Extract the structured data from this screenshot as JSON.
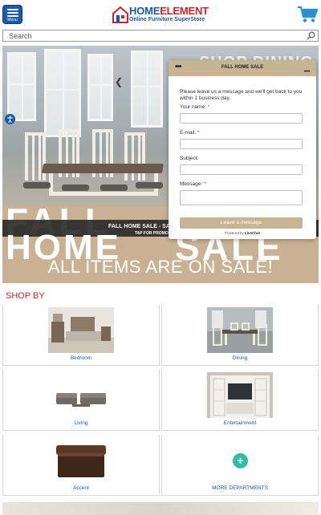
{
  "header": {
    "menu_label": "Menu",
    "brand_home": "HOME",
    "brand_element": "ELEMENT",
    "tagline": "Online Furniture SuperStore"
  },
  "search": {
    "placeholder": "Search"
  },
  "hero": {
    "headline_top": "SHOP DINING",
    "fall": "FALL",
    "home": "HOME",
    "sale": "SALE",
    "all_items": "ALL ITEMS ARE ON SALE!",
    "strip_text": "FALL HOME SALE - SA",
    "strip_sub": "TAP FOR PROMO"
  },
  "chat": {
    "title": "FALL HOME SALE",
    "intro": "Please leave us a message and we'll get back to you within 1 business day.",
    "fields": [
      {
        "label": "Your name:",
        "required": true
      },
      {
        "label": "E-mail:",
        "required": true
      },
      {
        "label": "Subject:",
        "required": false
      },
      {
        "label": "Message:",
        "required": true
      }
    ],
    "submit_label": "Leave a message",
    "powered_prefix": "Powered by",
    "powered_brand": "LiveChat"
  },
  "shop_by": {
    "title": "SHOP BY",
    "categories": [
      {
        "name": "Bedroom"
      },
      {
        "name": "Dining"
      },
      {
        "name": "Living"
      },
      {
        "name": "Entertainment"
      },
      {
        "name": "Accent"
      },
      {
        "name": "MORE DEPARTMENTS"
      }
    ]
  },
  "colors": {
    "brand_blue": "#1b5aa8",
    "brand_red": "#c9252c",
    "sale_tan": "#c9b293",
    "plus_green": "#2fbf9f"
  }
}
